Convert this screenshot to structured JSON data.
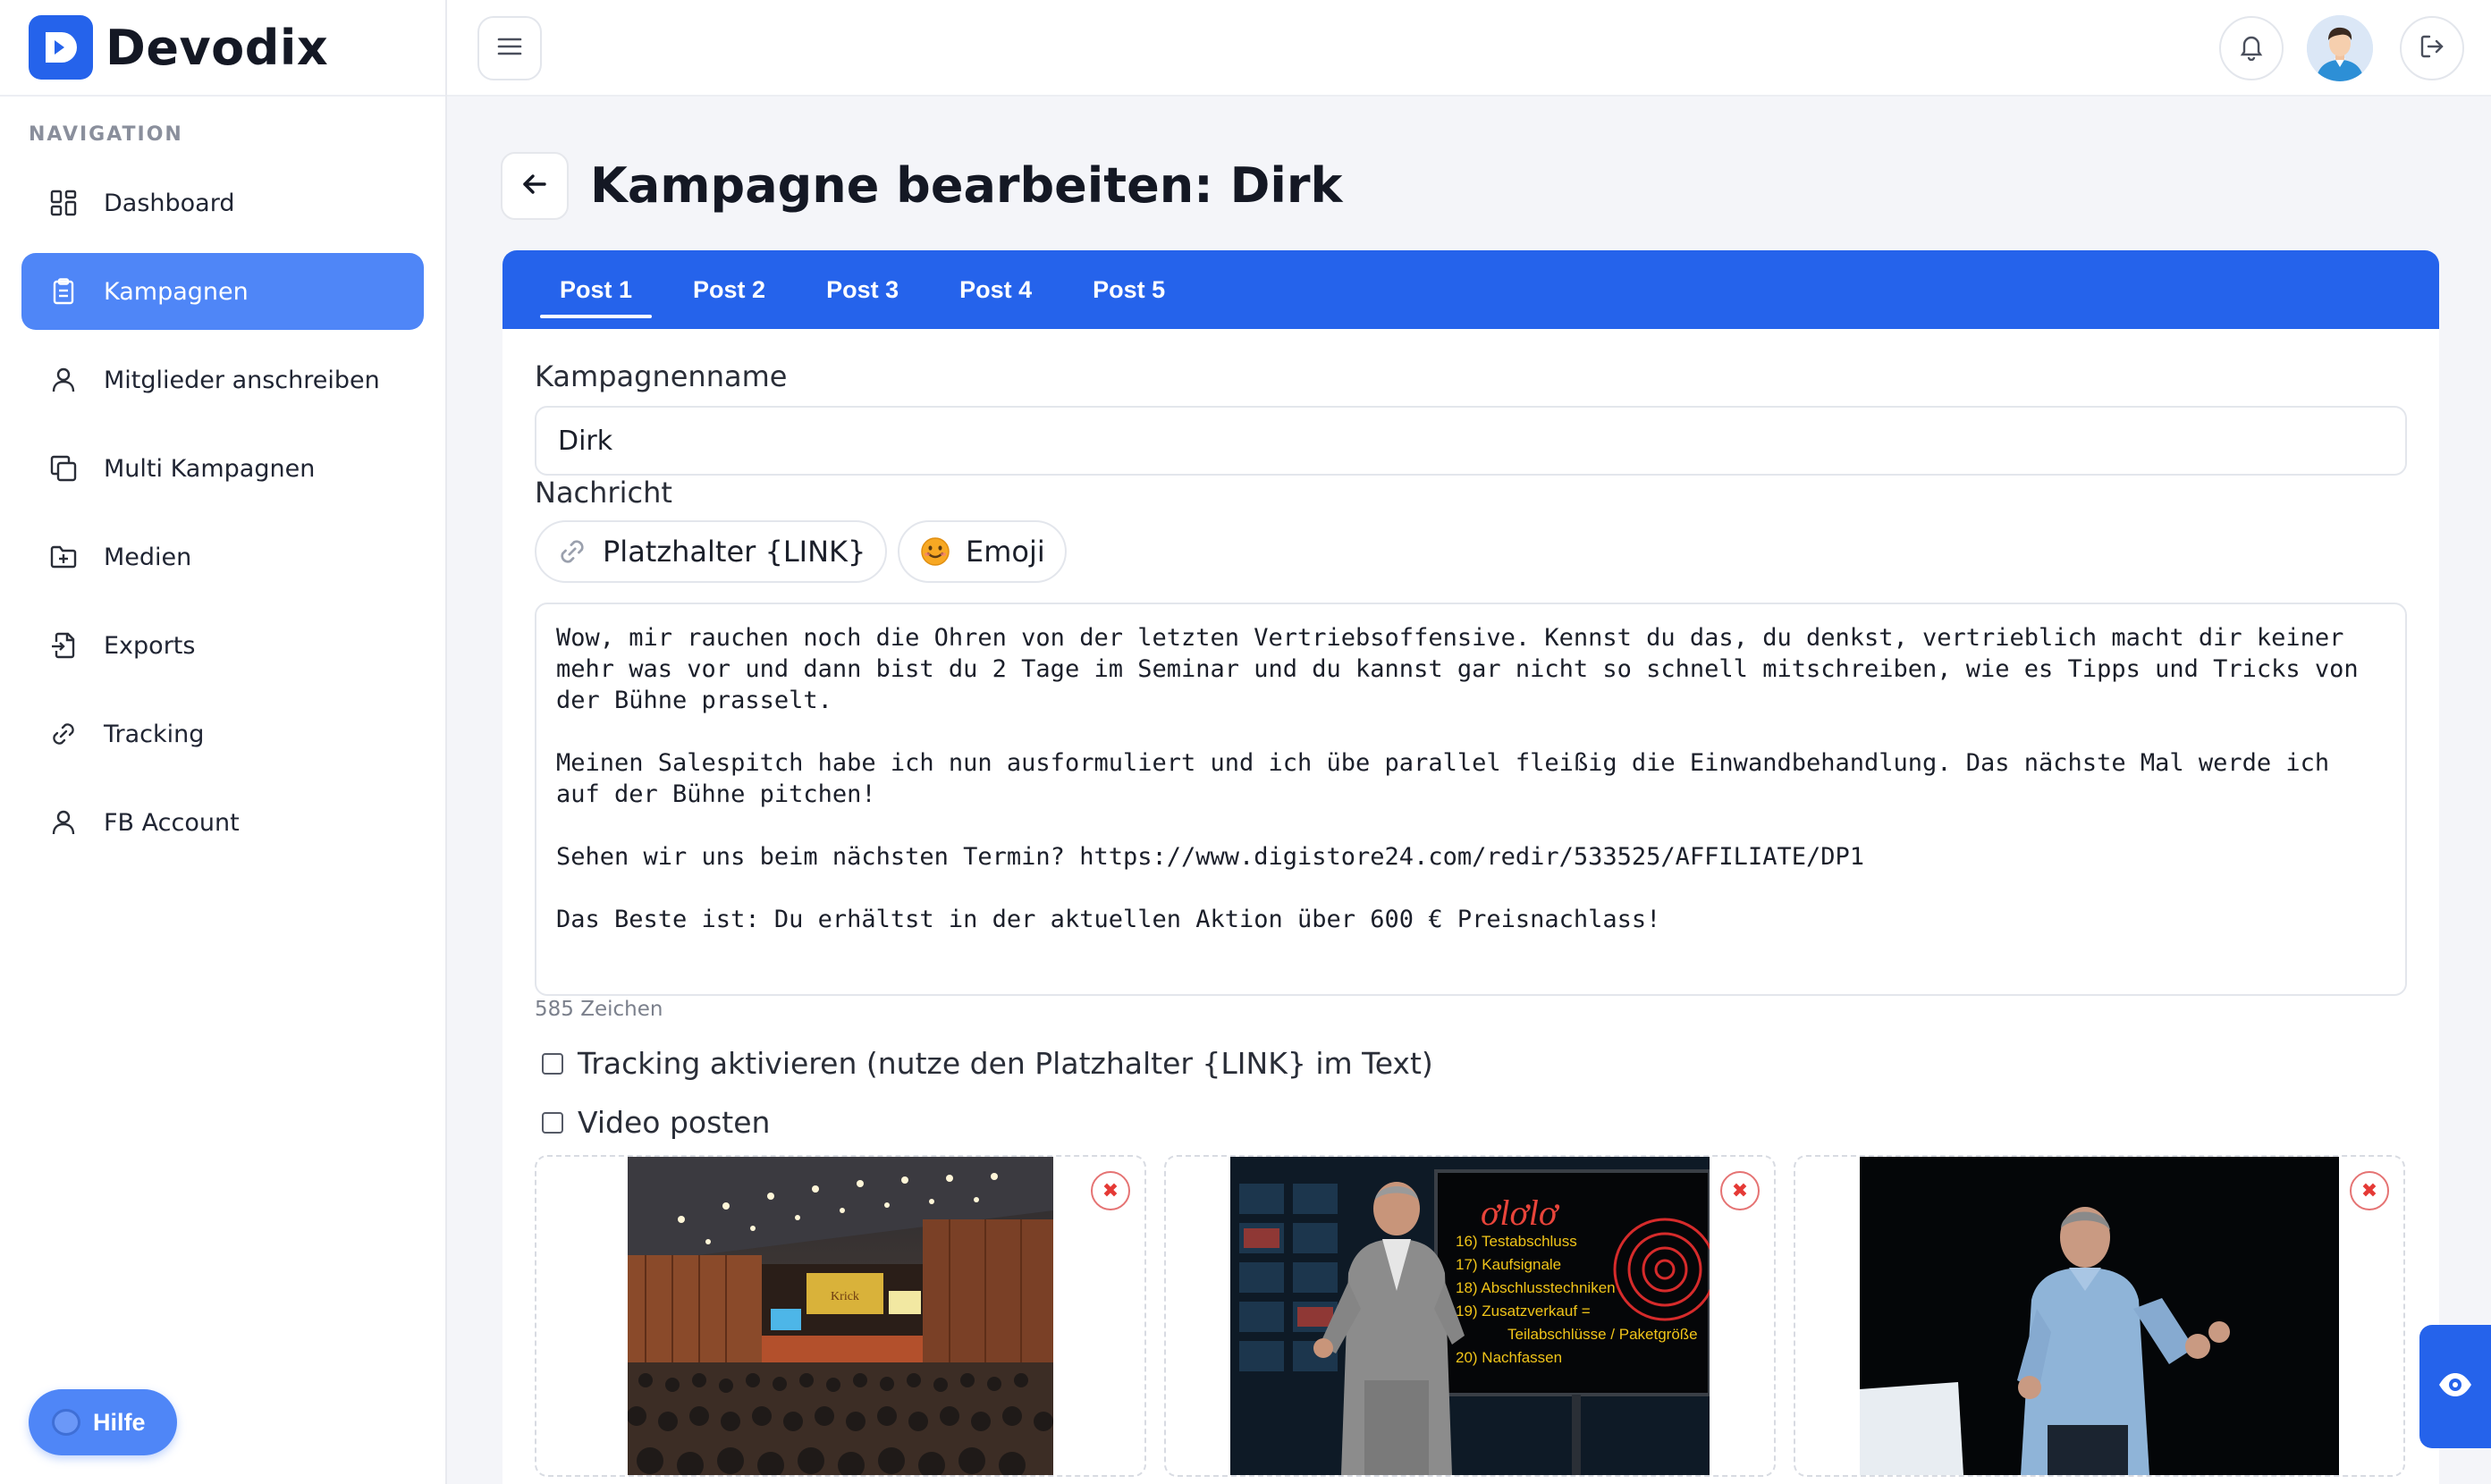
{
  "brand": {
    "name": "Devodix",
    "accent": "#2563eb"
  },
  "sidebar": {
    "heading": "NAVIGATION",
    "items": [
      {
        "label": "Dashboard",
        "icon": "grid-icon"
      },
      {
        "label": "Kampagnen",
        "icon": "clipboard-icon",
        "active": true
      },
      {
        "label": "Mitglieder anschreiben",
        "icon": "user-icon"
      },
      {
        "label": "Multi Kampagnen",
        "icon": "copy-icon"
      },
      {
        "label": "Medien",
        "icon": "folder-plus-icon"
      },
      {
        "label": "Exports",
        "icon": "file-export-icon"
      },
      {
        "label": "Tracking",
        "icon": "link-icon"
      },
      {
        "label": "FB Account",
        "icon": "user-icon"
      }
    ],
    "help_label": "Hilfe"
  },
  "page": {
    "title": "Kampagne bearbeiten: Dirk"
  },
  "tabs": [
    {
      "label": "Post 1",
      "active": true
    },
    {
      "label": "Post 2"
    },
    {
      "label": "Post 3"
    },
    {
      "label": "Post 4"
    },
    {
      "label": "Post 5"
    }
  ],
  "form": {
    "name_label": "Kampagnenname",
    "name_value": "Dirk",
    "message_label": "Nachricht",
    "placeholder_button": "Platzhalter {LINK}",
    "emoji_button": "Emoji",
    "message_text": "Wow, mir rauchen noch die Ohren von der letzten Vertriebsoffensive. Kennst du das, du denkst, vertrieblich macht dir keiner mehr was vor und dann bist du 2 Tage im Seminar und du kannst gar nicht so schnell mitschreiben, wie es Tipps und Tricks von der Bühne prasselt.\n\nMeinen Salespitch habe ich nun ausformuliert und ich übe parallel fleißig die Einwandbehandlung. Das nächste Mal werde ich auf der Bühne pitchen!\n\nSehen wir uns beim nächsten Termin? https://www.digistore24.com/redir/533525/AFFILIATE/DP1\n\nDas Beste ist: Du erhältst in der aktuellen Aktion über 600 € Preisnachlass!",
    "char_count": "585 Zeichen",
    "tracking_label": "Tracking aktivieren (nutze den Platzhalter {LINK} im Text)",
    "video_label": "Video posten"
  },
  "media": {
    "slide_lines": [
      "16) Testabschluss",
      "17) Kaufsignale",
      "18) Abschlusstechniken",
      "19) Zusatzverkauf =",
      "Teilabschlüsse / Paketgröße",
      "20) Nachfassen"
    ],
    "remove_symbol": "✖"
  }
}
